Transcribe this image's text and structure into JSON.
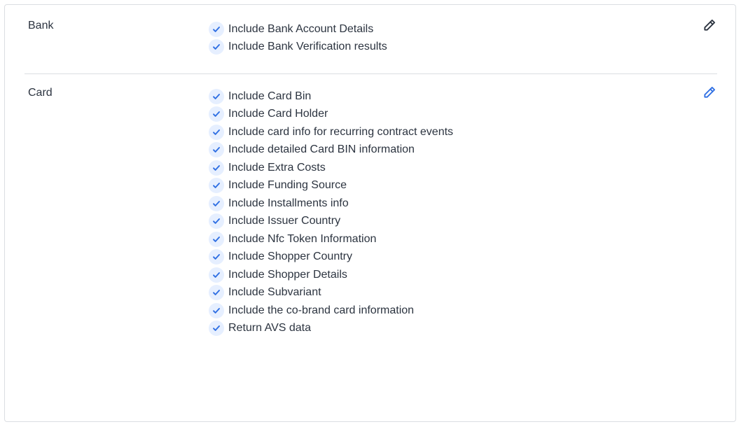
{
  "sections": [
    {
      "label": "Bank",
      "edit_icon": "pencil-icon",
      "edit_color": "#2c3440",
      "items": [
        {
          "label": "Include Bank Account Details",
          "checked": true
        },
        {
          "label": "Include Bank Verification results",
          "checked": true
        }
      ]
    },
    {
      "label": "Card",
      "edit_icon": "pencil-icon",
      "edit_color": "#2f6fe3",
      "items": [
        {
          "label": "Include Card Bin",
          "checked": true
        },
        {
          "label": "Include Card Holder",
          "checked": true
        },
        {
          "label": "Include card info for recurring contract events",
          "checked": true
        },
        {
          "label": "Include detailed Card BIN information",
          "checked": true
        },
        {
          "label": "Include Extra Costs",
          "checked": true
        },
        {
          "label": "Include Funding Source",
          "checked": true
        },
        {
          "label": "Include Installments info",
          "checked": true
        },
        {
          "label": "Include Issuer Country",
          "checked": true
        },
        {
          "label": "Include Nfc Token Information",
          "checked": true
        },
        {
          "label": "Include Shopper Country",
          "checked": true
        },
        {
          "label": "Include Shopper Details",
          "checked": true
        },
        {
          "label": "Include Subvariant",
          "checked": true
        },
        {
          "label": "Include the co-brand card information",
          "checked": true
        },
        {
          "label": "Return AVS data",
          "checked": true
        }
      ]
    }
  ],
  "colors": {
    "check_bg": "#e6efff",
    "check_mark": "#2f6fe3",
    "text": "#2c3440",
    "divider": "#dbdee2"
  }
}
